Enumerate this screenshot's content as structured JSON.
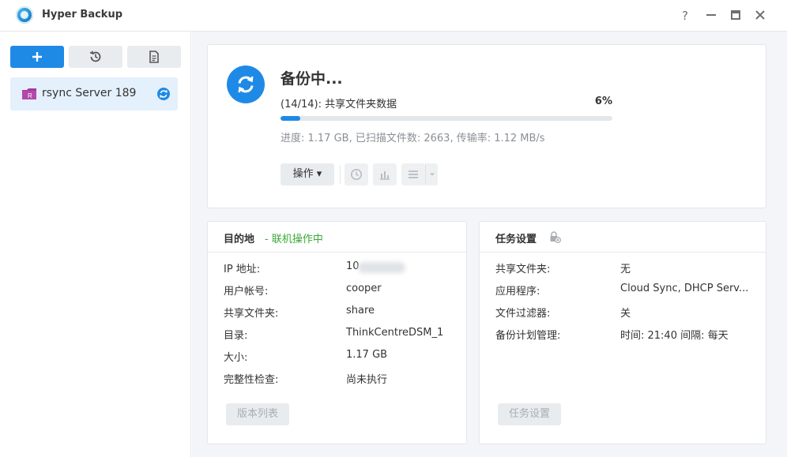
{
  "window": {
    "title": "Hyper Backup",
    "help_glyph": "?",
    "minimize_glyph": "—",
    "maximize_glyph": "▭",
    "close_glyph": "✕"
  },
  "sidebar": {
    "tasks": [
      {
        "label": "rsync Server 189",
        "icon": "folder-rsync-icon",
        "status_icon": "sync-icon"
      }
    ]
  },
  "status": {
    "title": "备份中...",
    "step": "(14/14): 共享文件夹数据",
    "percent_text": "6%",
    "progress_fraction": 0.06,
    "detail": "进度: 1.17 GB, 已扫描文件数: 2663, 传输率: 1.12 MB/s",
    "action_label": "操作 ▾"
  },
  "destination": {
    "title": "目的地",
    "online_status": "- 联机操作中",
    "rows": [
      {
        "label": "IP 地址:",
        "value": "10"
      },
      {
        "label": "用户帐号:",
        "value": "cooper"
      },
      {
        "label": "共享文件夹:",
        "value": "share"
      },
      {
        "label": "目录:",
        "value": "ThinkCentreDSM_1"
      },
      {
        "label": "大小:",
        "value": "1.17 GB"
      },
      {
        "label": "完整性检查:",
        "value": "尚未执行"
      }
    ],
    "button_label": "版本列表"
  },
  "task_settings": {
    "title": "任务设置",
    "rows": [
      {
        "label": "共享文件夹:",
        "value": "无"
      },
      {
        "label": "应用程序:",
        "value": "Cloud Sync, DHCP Serv..."
      },
      {
        "label": "文件过滤器:",
        "value": "关"
      },
      {
        "label": "备份计划管理:",
        "value": "时间: 21:40 间隔: 每天"
      }
    ],
    "button_label": "任务设置"
  },
  "colors": {
    "accent": "#1f8ae6",
    "online": "#3aa935",
    "selected_bg": "#e4f0fc"
  }
}
